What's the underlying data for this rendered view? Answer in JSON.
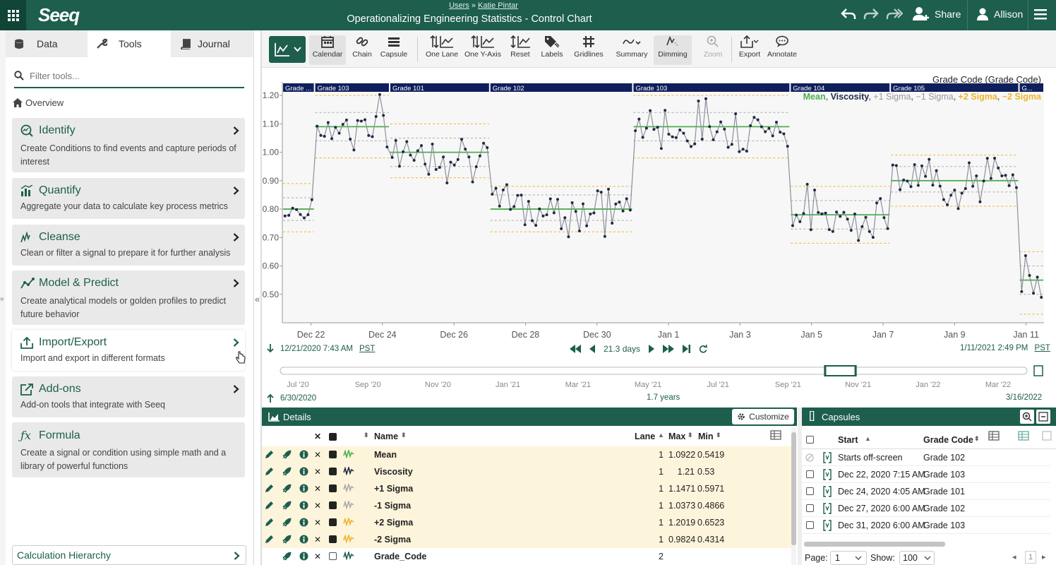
{
  "header": {
    "breadcrumb_users": "Users",
    "breadcrumb_sep": "»",
    "breadcrumb_owner": "Katie Pintar",
    "title": "Operationalizing Engineering Statistics - Control Chart",
    "share_label": "Share",
    "user_label": "Allison",
    "logo": "Seeq"
  },
  "left_tabs": {
    "data": "Data",
    "tools": "Tools",
    "journal": "Journal"
  },
  "filter": {
    "placeholder": "Filter tools..."
  },
  "overview": "Overview",
  "tools": [
    {
      "title": "Identify",
      "desc": "Create Conditions to find events and capture periods of interest"
    },
    {
      "title": "Quantify",
      "desc": "Aggregate your data to calculate key process metrics"
    },
    {
      "title": "Cleanse",
      "desc": "Clean or filter a signal to prepare it for further analysis"
    },
    {
      "title": "Model & Predict",
      "desc": "Create analytical models or golden profiles to predict future behavior"
    },
    {
      "title": "Import/Export",
      "desc": "Import and export in different formats"
    },
    {
      "title": "Add-ons",
      "desc": "Add-on tools that integrate with Seeq"
    },
    {
      "title": "Formula",
      "desc": "Create a signal or condition using simple math and a library of powerful functions"
    }
  ],
  "calc_hierarchy": "Calculation Hierarchy",
  "toolbar": {
    "calendar": "Calendar",
    "chain": "Chain",
    "capsule": "Capsule",
    "one_lane": "One Lane",
    "one_y_axis": "One Y-Axis",
    "reset": "Reset",
    "labels": "Labels",
    "gridlines": "Gridlines",
    "summary": "Summary",
    "dimming": "Dimming",
    "zoom": "Zoom",
    "export": "Export",
    "annotate": "Annotate"
  },
  "colors": {
    "brand": "#1d5e4d",
    "series_line": "#8a8f99",
    "mean": "#4caf50",
    "sigma1": "#999999",
    "sigma2": "#f0b429",
    "capsule_bar": "#0f1f5c"
  },
  "chart_data": {
    "type": "line",
    "condition_title": "Grade Code (Grade Code)",
    "legend": {
      "mean": "Mean",
      "sep1": ",",
      "viscosity": "Viscosity",
      "sep2": ",",
      "p1": "+1 Sigma",
      "sep3": ",",
      "m1": "−1 Sigma",
      "sep4": ",",
      "p2": "+2 Sigma",
      "sep5": ",",
      "m2": "−2 Sigma"
    },
    "ylim": [
      0.4,
      1.25
    ],
    "y_ticks": [
      "1.20",
      "1.10",
      "1.00",
      "0.90",
      "0.80",
      "0.70",
      "0.60",
      "0.50"
    ],
    "x_ticks": [
      "Dec 22",
      "Dec 24",
      "Dec 26",
      "Dec 28",
      "Dec 30",
      "Jan 1",
      "Jan 3",
      "Jan 5",
      "Jan 7",
      "Jan 9",
      "Jan 11"
    ],
    "x_start": "2020-12-21",
    "x_span_days": 21.3,
    "capsules": [
      {
        "label": "Grade ...",
        "start": 0.0,
        "end": 0.9,
        "mean": 0.8,
        "p1": 0.84,
        "m1": 0.76,
        "p2": 0.89,
        "m2": 0.72
      },
      {
        "label": "Grade 103",
        "start": 0.9,
        "end": 3.0,
        "mean": 1.09,
        "p1": 1.14,
        "m1": 1.04,
        "p2": 1.2,
        "m2": 0.98
      },
      {
        "label": "Grade 101",
        "start": 3.0,
        "end": 5.8,
        "mean": 1.0,
        "p1": 1.05,
        "m1": 0.95,
        "p2": 1.1,
        "m2": 0.91
      },
      {
        "label": "Grade 102",
        "start": 5.8,
        "end": 9.8,
        "mean": 0.8,
        "p1": 0.85,
        "m1": 0.76,
        "p2": 0.88,
        "m2": 0.72
      },
      {
        "label": "Grade 103",
        "start": 9.8,
        "end": 14.2,
        "mean": 1.09,
        "p1": 1.14,
        "m1": 1.04,
        "p2": 1.2,
        "m2": 0.98
      },
      {
        "label": "Grade 104",
        "start": 14.2,
        "end": 17.0,
        "mean": 0.78,
        "p1": 0.83,
        "m1": 0.73,
        "p2": 0.88,
        "m2": 0.68
      },
      {
        "label": "Grade 105",
        "start": 17.0,
        "end": 20.6,
        "mean": 0.9,
        "p1": 0.95,
        "m1": 0.86,
        "p2": 0.99,
        "m2": 0.81
      },
      {
        "label": "G...",
        "start": 20.6,
        "end": 21.3,
        "mean": 0.55,
        "p1": 0.6,
        "m1": 0.5,
        "p2": 0.65,
        "m2": 0.43
      }
    ]
  },
  "timebar": {
    "start": "12/21/2020 7:43 AM",
    "end": "1/11/2021 2:49 PM",
    "tz": "PST",
    "duration": "21.3 days",
    "overview_start": "6/30/2020",
    "overview_end": "3/16/2022",
    "overview_span": "1.7 years",
    "overview_ticks": [
      "Jul '20",
      "Sep '20",
      "Nov '20",
      "Jan '21",
      "Mar '21",
      "May '21",
      "Jul '21",
      "Sep '21",
      "Nov '21",
      "Jan '22",
      "Mar '22"
    ],
    "window_fraction": [
      0.73,
      0.77
    ]
  },
  "details": {
    "title": "Details",
    "customize": "Customize",
    "columns": {
      "name": "Name",
      "lane": "Lane",
      "max": "Max",
      "min": "Min"
    },
    "rows": [
      {
        "name": "Mean",
        "lane": "1",
        "max": "1.0922",
        "min": "0.5419",
        "color": "#4caf50",
        "checked": true,
        "yellow": true
      },
      {
        "name": "Viscosity",
        "lane": "1",
        "max": "1.21",
        "min": "0.53",
        "color": "#1f2a44",
        "checked": true,
        "yellow": true
      },
      {
        "name": "+1 Sigma",
        "lane": "1",
        "max": "1.1471",
        "min": "0.5971",
        "color": "#aaaaaa",
        "checked": true,
        "yellow": true
      },
      {
        "name": "-1 Sigma",
        "lane": "1",
        "max": "1.0373",
        "min": "0.4866",
        "color": "#aaaaaa",
        "checked": true,
        "yellow": true
      },
      {
        "name": "+2 Sigma",
        "lane": "1",
        "max": "1.2019",
        "min": "0.6523",
        "color": "#f0b429",
        "checked": true,
        "yellow": true
      },
      {
        "name": "-2 Sigma",
        "lane": "1",
        "max": "0.9824",
        "min": "0.4314",
        "color": "#f0b429",
        "checked": true,
        "yellow": true
      },
      {
        "name": "Grade_Code",
        "lane": "2",
        "max": "",
        "min": "",
        "color": "#1d5e4d",
        "checked": false,
        "yellow": false
      }
    ]
  },
  "capsules_panel": {
    "title": "Capsules",
    "columns": {
      "start": "Start",
      "grade": "Grade Code"
    },
    "rows": [
      {
        "start": "Starts off-screen",
        "grade": "Grade 102"
      },
      {
        "start": "Dec 22, 2020 7:15 AM",
        "grade": "Grade 103"
      },
      {
        "start": "Dec 24, 2020 4:05 AM",
        "grade": "Grade 101"
      },
      {
        "start": "Dec 27, 2020 6:00 AM",
        "grade": "Grade 102"
      },
      {
        "start": "Dec 31, 2020 6:00 AM",
        "grade": "Grade 103"
      }
    ],
    "page_label": "Page:",
    "page_value": "1",
    "show_label": "Show:",
    "show_value": "100",
    "page_indicator": "1"
  }
}
